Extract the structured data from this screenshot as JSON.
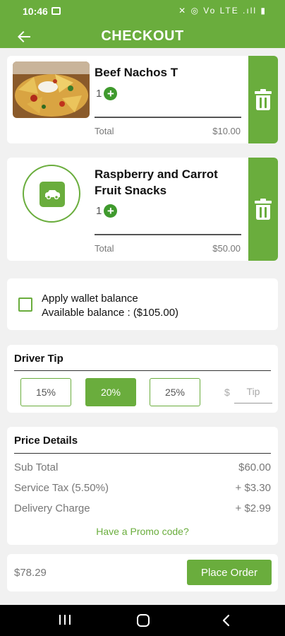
{
  "status_bar": {
    "time": "10:46",
    "indicators": "✕ ◎ Vo LTE .ıll ▮"
  },
  "header": {
    "title": "CHECKOUT",
    "back_icon": "arrow-left-icon"
  },
  "cart_items": [
    {
      "name": "Beef Nachos T",
      "quantity": "1",
      "total_label": "Total",
      "total_value": "$10.00",
      "image": "nachos-photo"
    },
    {
      "name": "Raspberry and Carrot Fruit Snacks",
      "quantity": "1",
      "total_label": "Total",
      "total_value": "$50.00",
      "image": "placeholder-image-icon"
    }
  ],
  "wallet": {
    "label": "Apply wallet balance",
    "balance": "Available balance : ($105.00)",
    "checked": false
  },
  "driver_tip": {
    "title": "Driver Tip",
    "options": [
      "15%",
      "20%",
      "25%"
    ],
    "selected": "20%",
    "currency_symbol": "$",
    "custom_placeholder": "Tip"
  },
  "price_details": {
    "title": "Price Details",
    "rows": [
      {
        "label": "Sub Total",
        "value": "$60.00"
      },
      {
        "label": "Service Tax (5.50%)",
        "value": "+ $3.30"
      },
      {
        "label": "Delivery Charge",
        "value": "+ $2.99"
      }
    ],
    "promo_link": "Have a Promo code?"
  },
  "footer": {
    "total": "$78.29",
    "place_order_label": "Place Order"
  },
  "colors": {
    "brand": "#6aad3d",
    "accent": "#3f9a2d",
    "background": "#f1f1f1"
  }
}
